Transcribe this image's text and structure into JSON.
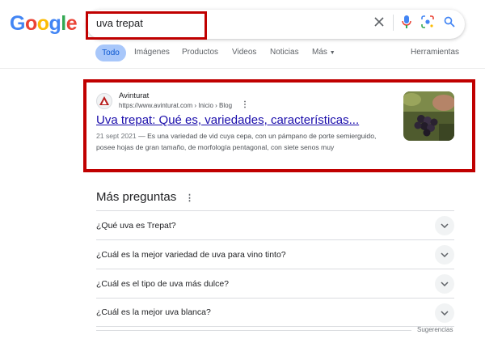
{
  "logo": {
    "text": "Google"
  },
  "search": {
    "query": "uva trepat"
  },
  "tabs": {
    "active": "Todo",
    "items": [
      "Imágenes",
      "Productos",
      "Videos",
      "Noticias",
      "Más"
    ],
    "tools": "Herramientas"
  },
  "result": {
    "site_name": "Avinturat",
    "url": "https://www.avinturat.com › Inicio › Blog",
    "title": "Uva trepat: Qué es, variedades, características...",
    "date": "21 sept 2021",
    "snippet": " — Es una variedad de vid cuya cepa, con un pámpano de porte semierguido, posee hojas de gran tamaño, de morfología pentagonal, con siete senos muy"
  },
  "paa": {
    "title": "Más preguntas",
    "questions": [
      "¿Qué uva es Trepat?",
      "¿Cuál es la mejor variedad de uva para vino tinto?",
      "¿Cuál es el tipo de uva más dulce?",
      "¿Cuál es la mejor uva blanca?"
    ],
    "footer": "Sugerencias"
  },
  "colors": {
    "highlight": "#c00000",
    "link": "#1a0dab",
    "active_tab_bg": "#a8c7fa",
    "active_tab_text": "#0b57d0"
  },
  "icons": [
    "clear-icon",
    "mic-icon",
    "lens-icon",
    "search-icon",
    "kebab-icon",
    "chevron-down-icon",
    "caret-down-icon"
  ]
}
